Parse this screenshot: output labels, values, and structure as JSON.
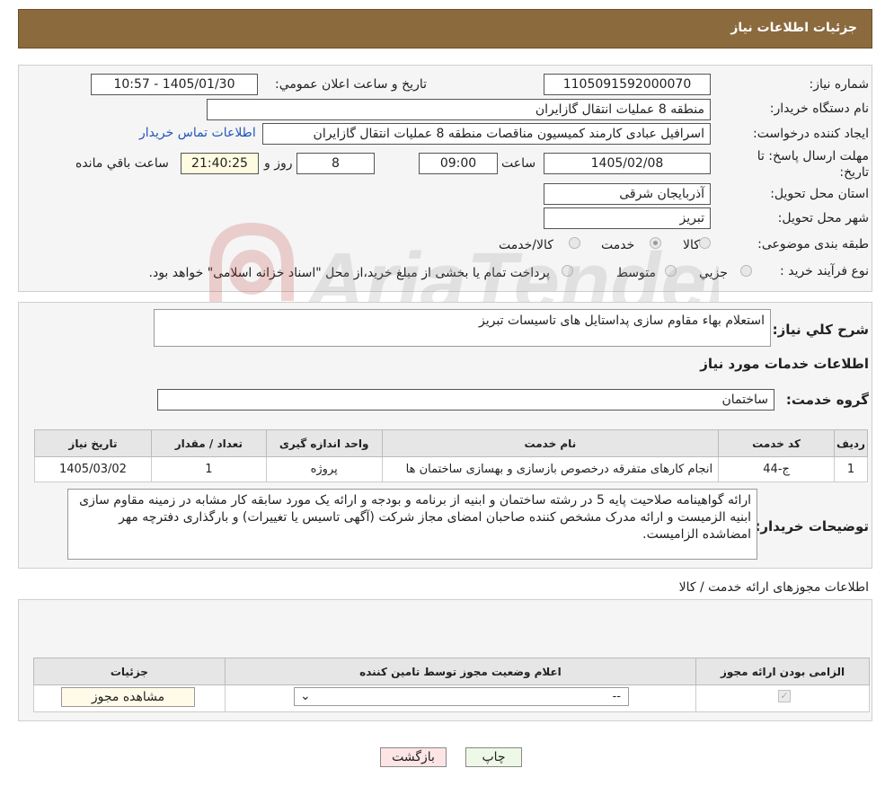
{
  "header": {
    "title": "جزئیات اطلاعات نیاز"
  },
  "form": {
    "need_number_label": "شماره نیاز:",
    "need_number": "1105091592000070",
    "announce_label": "تاریخ و ساعت اعلان عمومي:",
    "announce_value": "1405/01/30 - 10:57",
    "buyer_label": "نام دستگاه خريدار:",
    "buyer_value": "منطقه 8 عمليات انتقال گازايران",
    "creator_label": "ايجاد کننده درخواست:",
    "creator_value": "اسرافيل عبادی کارمند کمیسیون مناقصات منطقه 8 عمليات انتقال گازايران",
    "contact_link": "اطلاعات تماس خریدار",
    "deadline_label": "مهلت ارسال پاسخ: تا تاريخ:",
    "deadline_date": "1405/02/08",
    "time_label": "ساعت",
    "deadline_time": "09:00",
    "days_value": "8",
    "days_label": "روز و",
    "remaining_time": "21:40:25",
    "remaining_label": "ساعت باقي مانده",
    "province_label": "استان محل تحويل:",
    "province_value": "آذربايجان شرقی",
    "city_label": "شهر محل تحويل:",
    "city_value": "تبریز",
    "category_label": "طبقه بندی موضوعی:",
    "category_options": [
      "کالا",
      "خدمت",
      "کالا/خدمت"
    ],
    "category_selected": "خدمت",
    "process_label": "نوع فرآيند خريد :",
    "process_options": [
      "جزيي",
      "متوسط"
    ],
    "process_note": "پرداخت تمام یا بخشی از مبلغ خرید،از محل \"اسناد خزانه اسلامی\" خواهد بود."
  },
  "summary": {
    "label": "شرح کلي نياز:",
    "value": "استعلام بهاء  مقاوم سازی پداستایل های تاسیسات تبریز",
    "services_heading": "اطلاعات خدمات مورد نياز",
    "group_label": "گروه خدمت:",
    "group_value": "ساختمان"
  },
  "services_table": {
    "headers": [
      "رديف",
      "کد خدمت",
      "نام خدمت",
      "واحد اندازه گيری",
      "تعداد / مقدار",
      "تاريخ نياز"
    ],
    "rows": [
      {
        "row": "1",
        "code": "ج-44",
        "name": "انجام کارهای متفرقه درخصوص بازسازی و بهسازی ساختمان ها",
        "unit": "پروژه",
        "qty": "1",
        "date": "1405/03/02"
      }
    ]
  },
  "buyer_notes": {
    "label": "توضيحات خريدار:",
    "value": "ارائه گواهینامه صلاحیت پایه 5 در رشته ساختمان و ابنیه از برنامه و بودجه و ارائه یک مورد سابقه کار مشابه در زمینه مقاوم سازی ابنیه الزمیست و ارائه مدرک مشخص کننده صاحبان امضای مجاز شرکت (آگهی تاسیس یا تغییرات) و بارگذاری دفترچه مهر امضاشده الزامیست."
  },
  "permits": {
    "heading": "اطلاعات مجوزهای ارائه خدمت / کالا",
    "headers": [
      "الزامی بودن ارائه مجوز",
      "اعلام وضعیت مجوز توسط تامین کننده",
      "جزئیات"
    ],
    "select_value": "--",
    "view_button": "مشاهده مجوز"
  },
  "buttons": {
    "print": "چاپ",
    "back": "بازگشت"
  },
  "colors": {
    "header_bg": "#8b6a3e",
    "link": "#2255bb",
    "back_bg": "#fde5e5",
    "print_bg": "#eef8e6"
  },
  "watermark": {
    "text": "AriaTender.neT"
  }
}
